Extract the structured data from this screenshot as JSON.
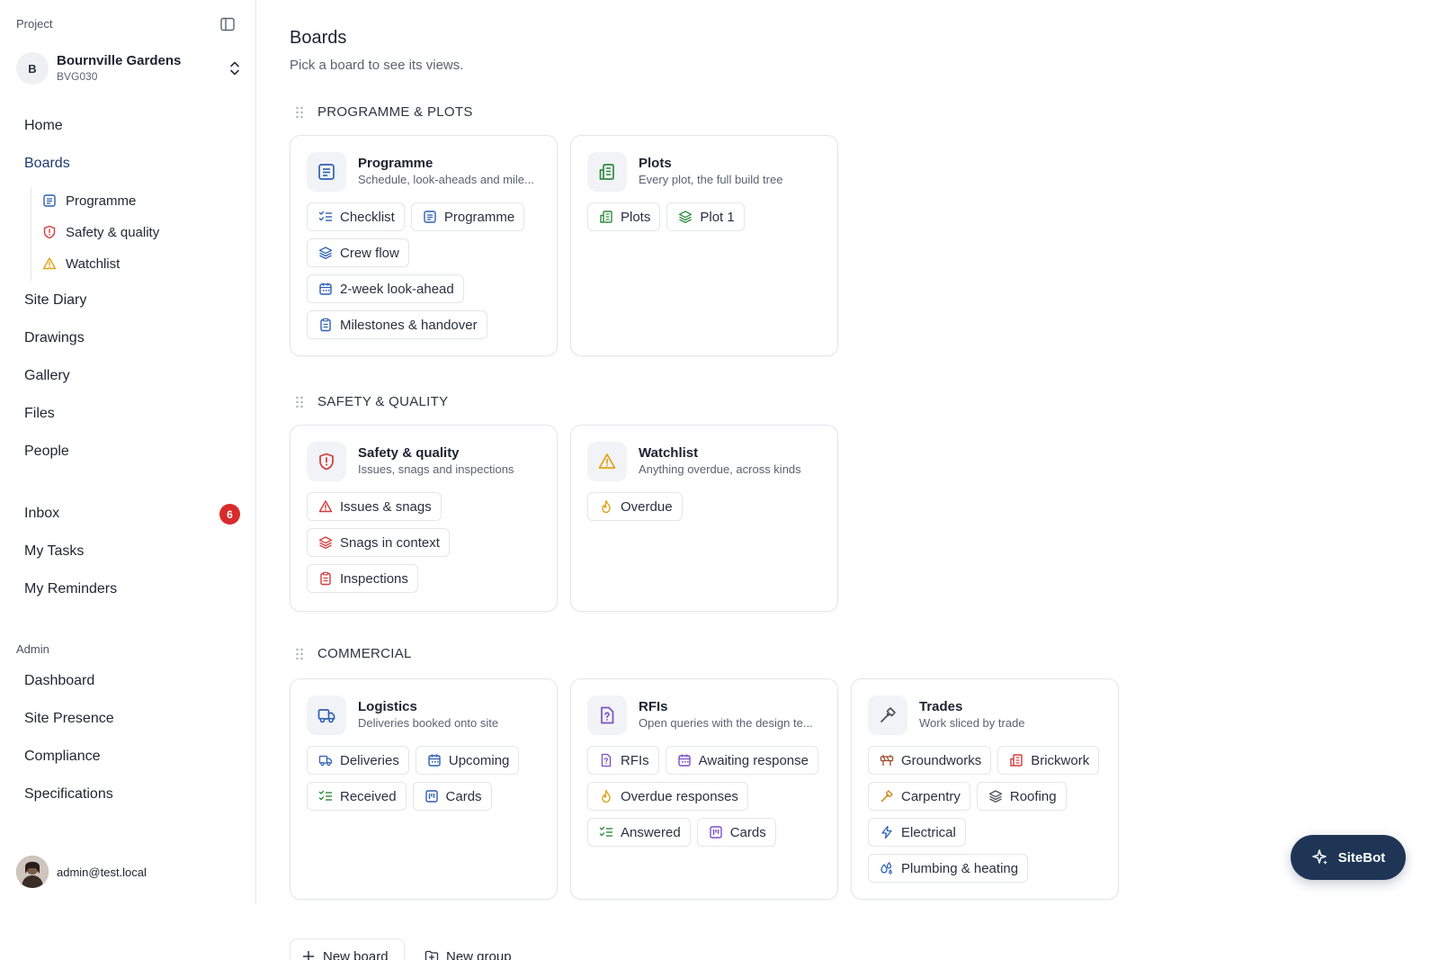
{
  "sidebar": {
    "project_label": "Project",
    "project": {
      "initial": "B",
      "name": "Bournville Gardens",
      "code": "BVG030"
    },
    "nav": {
      "home": "Home",
      "boards": "Boards",
      "boards_sub": [
        "Programme",
        "Safety & quality",
        "Watchlist"
      ],
      "site_diary": "Site Diary",
      "drawings": "Drawings",
      "gallery": "Gallery",
      "files": "Files",
      "people": "People",
      "inbox": "Inbox",
      "inbox_count": "6",
      "my_tasks": "My Tasks",
      "my_reminders": "My Reminders"
    },
    "admin_label": "Admin",
    "admin": {
      "dashboard": "Dashboard",
      "site_presence": "Site Presence",
      "compliance": "Compliance",
      "specifications": "Specifications"
    },
    "user_email": "admin@test.local"
  },
  "main": {
    "title": "Boards",
    "subtitle": "Pick a board to see its views.",
    "groups": [
      {
        "title": "PROGRAMME & PLOTS"
      },
      {
        "title": "SAFETY & QUALITY"
      },
      {
        "title": "COMMERCIAL"
      }
    ],
    "cards": {
      "programme": {
        "title": "Programme",
        "desc": "Schedule, look-aheads and mile...",
        "chips": [
          "Checklist",
          "Programme",
          "Crew flow",
          "2-week look-ahead",
          "Milestones & handover"
        ]
      },
      "plots": {
        "title": "Plots",
        "desc": "Every plot, the full build tree",
        "chips": [
          "Plots",
          "Plot 1"
        ]
      },
      "safety": {
        "title": "Safety & quality",
        "desc": "Issues, snags and inspections",
        "chips": [
          "Issues & snags",
          "Snags in context",
          "Inspections"
        ]
      },
      "watchlist": {
        "title": "Watchlist",
        "desc": "Anything overdue, across kinds",
        "chips": [
          "Overdue"
        ]
      },
      "logistics": {
        "title": "Logistics",
        "desc": "Deliveries booked onto site",
        "chips": [
          "Deliveries",
          "Upcoming",
          "Received",
          "Cards"
        ]
      },
      "rfis": {
        "title": "RFIs",
        "desc": "Open queries with the design te...",
        "chips": [
          "RFIs",
          "Awaiting response",
          "Overdue responses",
          "Answered",
          "Cards"
        ]
      },
      "trades": {
        "title": "Trades",
        "desc": "Work sliced by trade",
        "chips": [
          "Groundworks",
          "Brickwork",
          "Carpentry",
          "Roofing",
          "Electrical",
          "Plumbing & heating"
        ]
      }
    },
    "actions": {
      "new_board": "New board",
      "new_group": "New group"
    }
  },
  "sitebot_label": "SiteBot",
  "colors": {
    "blue": "#2f5fb3",
    "green": "#2f8a3e",
    "red": "#d23b3b",
    "amber": "#e0a21a",
    "purple": "#7b4fc4",
    "brown": "#9a4a2a",
    "navy": "#1f3556"
  }
}
